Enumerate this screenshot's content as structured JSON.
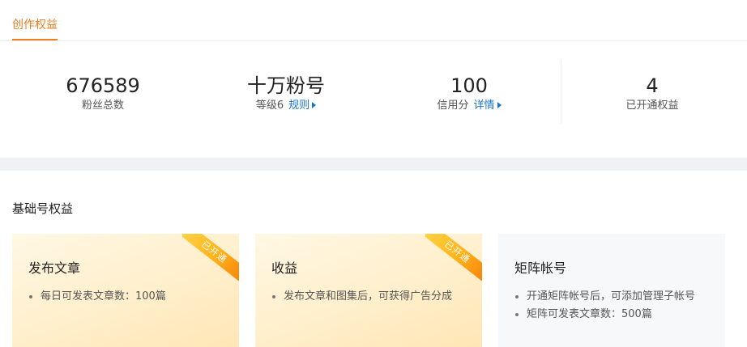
{
  "tabs": {
    "active_label": "创作权益"
  },
  "stats": {
    "fans": {
      "value": "676589",
      "label": "粉丝总数"
    },
    "level": {
      "value": "十万粉号",
      "label": "等级6",
      "link": "规则"
    },
    "credit": {
      "value": "100",
      "label": "信用分",
      "link": "详情"
    },
    "rights": {
      "value": "4",
      "label": "已开通权益"
    }
  },
  "section": {
    "title": "基础号权益"
  },
  "cards": [
    {
      "title": "发布文章",
      "badge": "已开通",
      "items": [
        "每日可发表文章数：100篇"
      ]
    },
    {
      "title": "收益",
      "badge": "已开通",
      "items": [
        "发布文章和图集后，可获得广告分成"
      ]
    },
    {
      "title": "矩阵帐号",
      "badge": "",
      "items": [
        "开通矩阵帐号后，可添加管理子帐号",
        "矩阵可发表文章数：500篇"
      ]
    }
  ],
  "colors": {
    "accent": "#ec7e1f",
    "link": "#1a73cf",
    "band": "#f0f1f4"
  }
}
